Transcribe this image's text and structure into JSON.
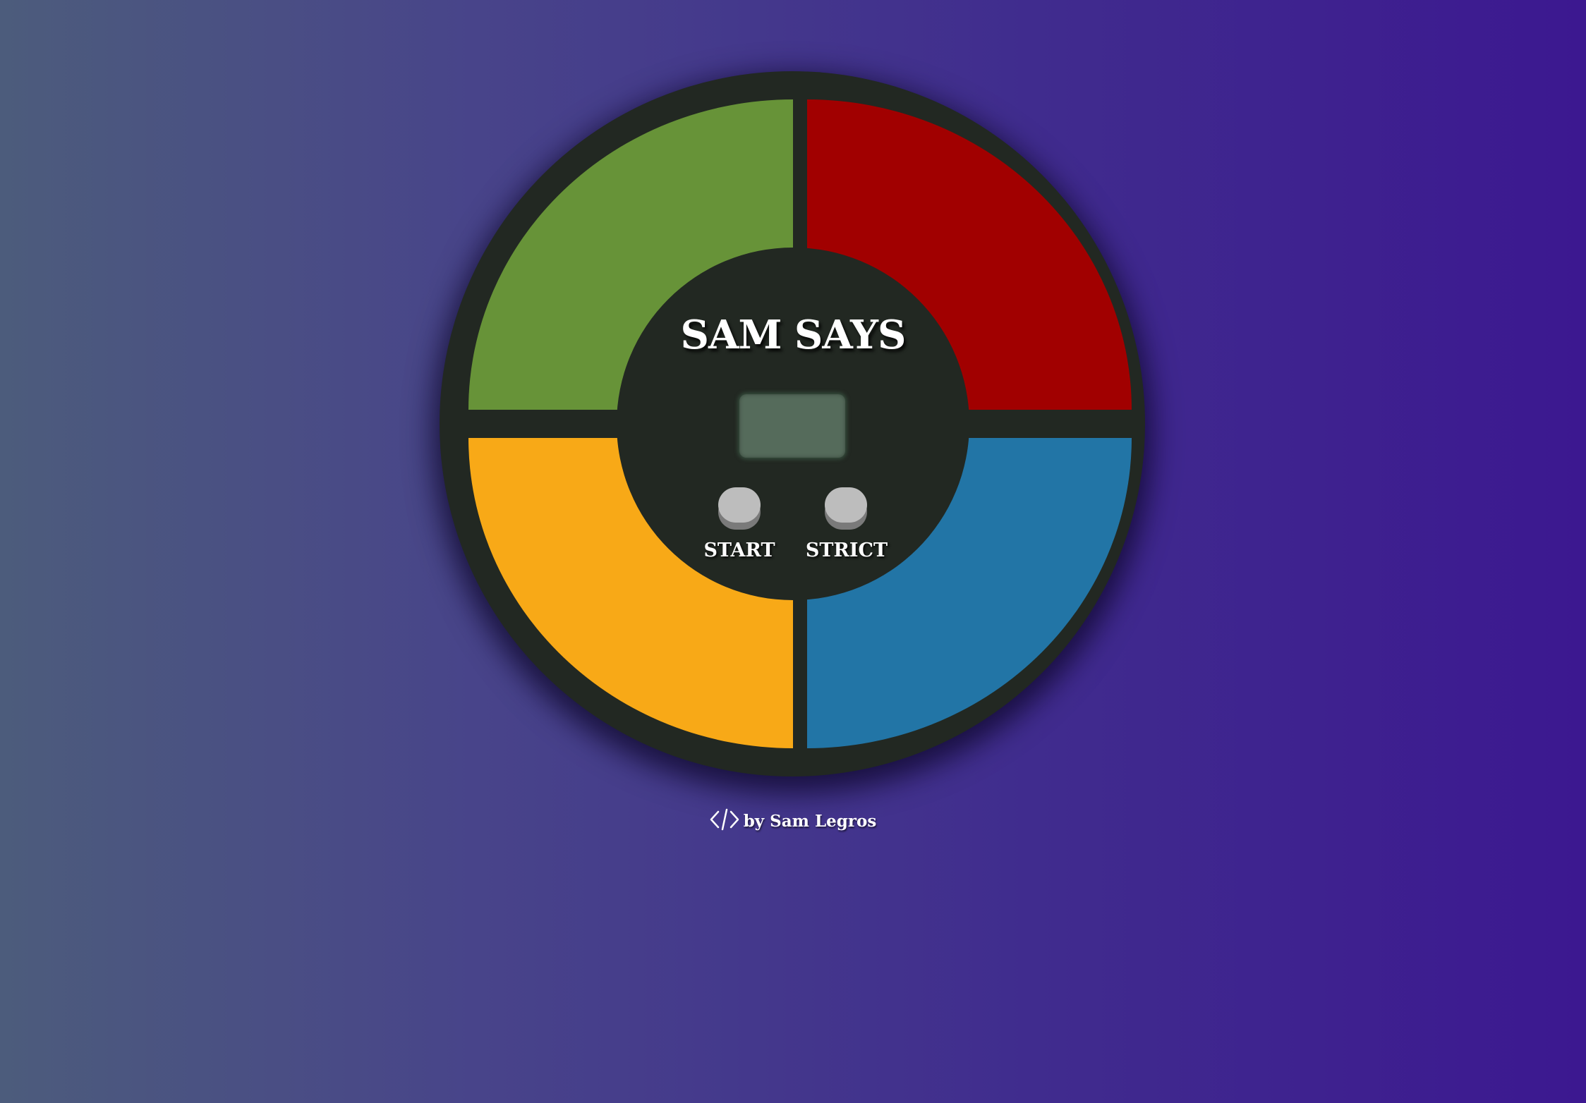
{
  "game": {
    "title": "SAM SAYS",
    "counter_value": "",
    "pads": [
      {
        "name": "green",
        "color": "#679338"
      },
      {
        "name": "red",
        "color": "#a10000"
      },
      {
        "name": "yellow",
        "color": "#f8a917"
      },
      {
        "name": "blue",
        "color": "#2275a6"
      }
    ],
    "controls": {
      "start_label": "START",
      "strict_label": "STRICT"
    }
  },
  "footer": {
    "icon": "code-icon",
    "credit": "by Sam Legros"
  }
}
